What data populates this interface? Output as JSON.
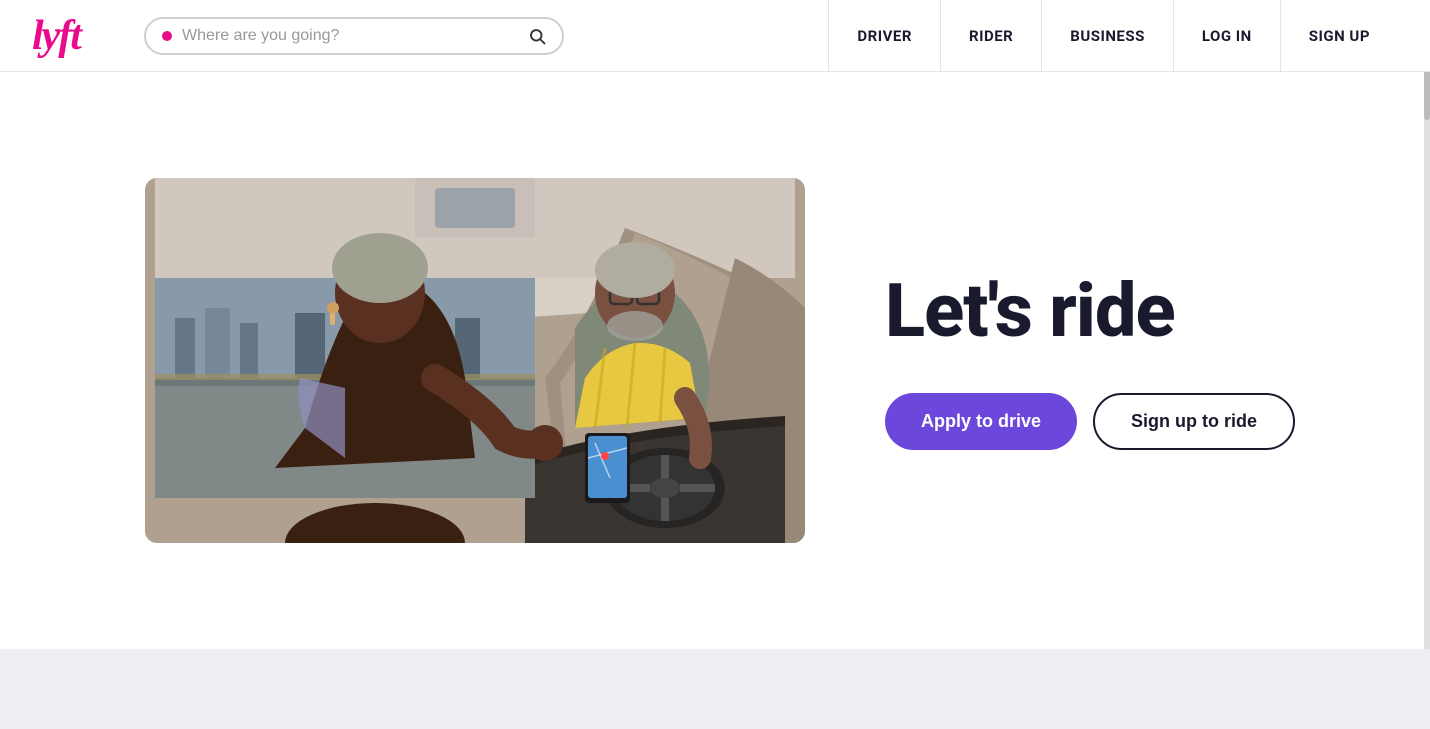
{
  "header": {
    "logo_text": "lyft",
    "search": {
      "placeholder": "Where are you going?"
    },
    "nav_items": [
      {
        "id": "driver",
        "label": "DRIVER"
      },
      {
        "id": "rider",
        "label": "RIDER"
      },
      {
        "id": "business",
        "label": "BUSINESS"
      },
      {
        "id": "login",
        "label": "LOG IN"
      },
      {
        "id": "signup",
        "label": "SIGN UP"
      }
    ]
  },
  "hero": {
    "heading": "Let's ride",
    "apply_button": "Apply to drive",
    "signup_button": "Sign up to ride"
  },
  "colors": {
    "lyft_pink": "#ea0b8c",
    "purple_btn": "#6b47dc",
    "dark_navy": "#1a1a2e"
  }
}
